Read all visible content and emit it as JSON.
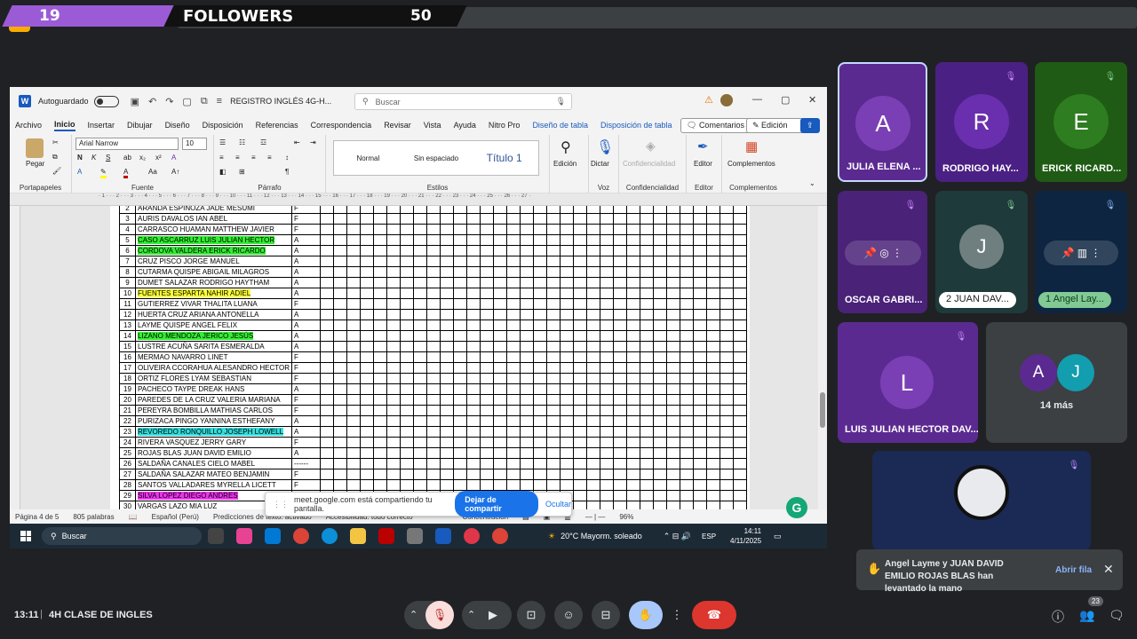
{
  "overlay": {
    "left_number": "19",
    "label": "FOLLOWERS",
    "right_number": "50"
  },
  "word": {
    "autosave_label": "Autoguardado",
    "doc_title": "REGISTRO INGLÉS 4G-H...",
    "search_placeholder": "Buscar",
    "menu": [
      "Archivo",
      "Inicio",
      "Insertar",
      "Dibujar",
      "Diseño",
      "Disposición",
      "Referencias",
      "Correspondencia",
      "Revisar",
      "Vista",
      "Ayuda",
      "Nitro Pro",
      "Diseño de tabla",
      "Disposición de tabla"
    ],
    "comments_button": "Comentarios",
    "edit_button": "Edición",
    "font_name": "Arial Narrow",
    "font_size": "10",
    "paste_label": "Pegar",
    "groups": {
      "clipboard": "Portapapeles",
      "font": "Fuente",
      "paragraph": "Párrafo",
      "styles": "Estilos",
      "voice": "Voz",
      "confidentiality": "Confidencialidad",
      "editor": "Editor",
      "addins": "Complementos"
    },
    "styles": [
      "Normal",
      "Sin espaciado",
      "Título 1"
    ],
    "edicion_label": "Edición",
    "dictar_label": "Dictar",
    "confid_label": "Confidencialidad",
    "editor_label": "Editor",
    "complementos_label": "Complementos",
    "status": {
      "page": "Página 4 de 5",
      "words": "805 palabras",
      "lang": "Español (Perú)",
      "predictions": "Predicciones de texto: activado",
      "accessibility": "Accesibilidad: todo correcto",
      "focus": "Concentración",
      "zoom": "96%"
    }
  },
  "students": [
    {
      "n": "2",
      "name": "ARANDA ESPINOZA JADE MESUMI",
      "status": "F",
      "hl": ""
    },
    {
      "n": "3",
      "name": "AURIS DAVALOS IAN ABEL",
      "status": "F",
      "hl": ""
    },
    {
      "n": "4",
      "name": "CARRASCO HUAMAN MATTHEW JAVIER",
      "status": "F",
      "hl": ""
    },
    {
      "n": "5",
      "name": "CASO ASCARRUZ LUIS JULIAN HECTOR",
      "status": "A",
      "hl": "#33ee33"
    },
    {
      "n": "6",
      "name": "CORDOVA VALDERA ERICK RICARDO",
      "status": "A",
      "hl": "#33ee33"
    },
    {
      "n": "7",
      "name": "CRUZ PISCO JORGE MANUEL",
      "status": "A",
      "hl": ""
    },
    {
      "n": "8",
      "name": "CUTARMA QUISPE ABIGAIL MILAGROS",
      "status": "A",
      "hl": ""
    },
    {
      "n": "9",
      "name": "DUMET SALAZAR RODRIGO HAYTHAM",
      "status": "A",
      "hl": ""
    },
    {
      "n": "10",
      "name": "FUENTES ESPARTA NAHIR ADIEL",
      "status": "A",
      "hl": "#ffff33"
    },
    {
      "n": "11",
      "name": "GUTIERREZ VIVAR THALITA LUANA",
      "status": "F",
      "hl": ""
    },
    {
      "n": "12",
      "name": "HUERTA CRUZ ARIANA ANTONELLA",
      "status": "A",
      "hl": ""
    },
    {
      "n": "13",
      "name": "LAYME QUISPE ANGEL FELIX",
      "status": "A",
      "hl": ""
    },
    {
      "n": "14",
      "name": "LIZANO MENDOZA JERICO JESÚS",
      "status": "A",
      "hl": "#33ee33"
    },
    {
      "n": "15",
      "name": "LUSTRE ACUÑA SARITA ESMERALDA",
      "status": "A",
      "hl": ""
    },
    {
      "n": "16",
      "name": "MERMAO NAVARRO LINET",
      "status": "F",
      "hl": ""
    },
    {
      "n": "17",
      "name": "OLIVEIRA CCORAHUA ALESANDRO HECTOR",
      "status": "F",
      "hl": ""
    },
    {
      "n": "18",
      "name": "ORTIZ FLORES LYAM SEBASTIAN",
      "status": "F",
      "hl": ""
    },
    {
      "n": "19",
      "name": "PACHECO TAYPE DREAK HANS",
      "status": "A",
      "hl": ""
    },
    {
      "n": "20",
      "name": "PAREDES DE LA CRUZ VALERIA MARIANA",
      "status": "F",
      "hl": ""
    },
    {
      "n": "21",
      "name": "PEREYRA BOMBILLA MATHIAS CARLOS",
      "status": "F",
      "hl": ""
    },
    {
      "n": "22",
      "name": "PURIZACA PINGO YANNINA ESTHEFANY",
      "status": "A",
      "hl": ""
    },
    {
      "n": "23",
      "name": "REVOREDO RONQUILLO JOSEPH LOWELL",
      "status": "A",
      "hl": "#33dddd"
    },
    {
      "n": "24",
      "name": "RIVERA VASQUEZ JERRY GARY",
      "status": "F",
      "hl": ""
    },
    {
      "n": "25",
      "name": "ROJAS BLAS JUAN DAVID EMILIO",
      "status": "A",
      "hl": ""
    },
    {
      "n": "26",
      "name": "SALDAÑA CANALES CIELO MABEL",
      "status": "------",
      "hl": ""
    },
    {
      "n": "27",
      "name": "SALDAÑA SALAZAR MATEO BENJAMIN",
      "status": "F",
      "hl": ""
    },
    {
      "n": "28",
      "name": "SANTOS VALLADARES MYRELLA LICETT",
      "status": "F",
      "hl": ""
    },
    {
      "n": "29",
      "name": "SILVA LOPEZ DIEGO ANDRES",
      "status": "",
      "hl": "#ee33ee"
    },
    {
      "n": "30",
      "name": "VARGAS LAZO MIA LUZ",
      "status": "",
      "hl": ""
    }
  ],
  "taskbar": {
    "search": "Buscar",
    "weather": "20°C  Mayorm. soleado",
    "lang": "ESP",
    "time": "14:11",
    "date": "4/11/2025"
  },
  "share": {
    "text": "meet.google.com está compartiendo tu pantalla.",
    "stop": "Dejar de compartir",
    "hide": "Ocultar"
  },
  "participants": {
    "julia": {
      "initial": "A",
      "name": "JULIA ELENA ..."
    },
    "rodrigo": {
      "initial": "R",
      "name": "RODRIGO HAY..."
    },
    "erick": {
      "initial": "E",
      "name": "ERICK RICARD..."
    },
    "oscar": {
      "name": "OSCAR GABRI..."
    },
    "juan": {
      "initial": "J",
      "pill": "2 JUAN DAV..."
    },
    "angel": {
      "pill": "1 Angel Lay..."
    },
    "luis": {
      "initial": "L",
      "name": "LUIS JULIAN HECTOR DAV..."
    },
    "more": {
      "a": "A",
      "j": "J",
      "label": "14 más"
    }
  },
  "notification": {
    "text": "Angel Layme y JUAN DAVID EMILIO ROJAS BLAS han levantado la mano",
    "action": "Abrir fila"
  },
  "meeting": {
    "time": "13:11",
    "name": "4H CLASE DE INGLES",
    "people_count": "23"
  }
}
